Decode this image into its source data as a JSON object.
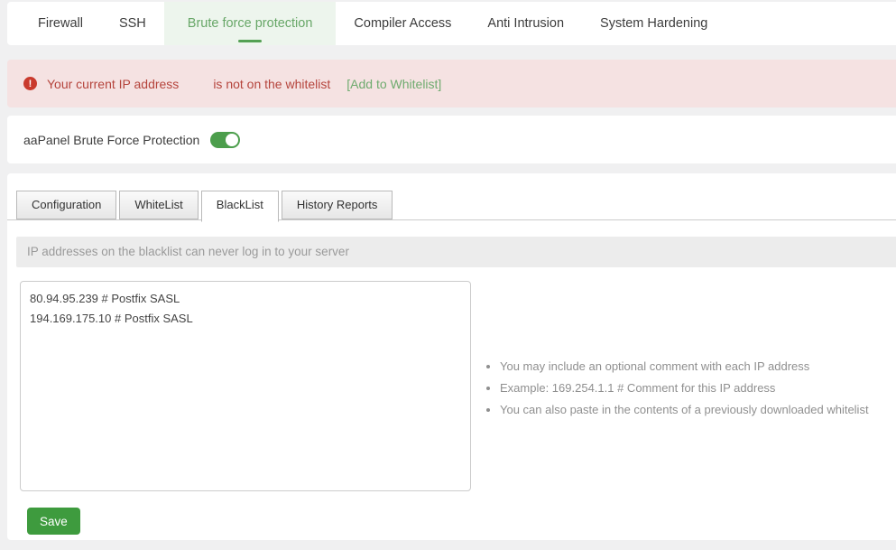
{
  "top_tabs": {
    "items": [
      {
        "label": "Firewall"
      },
      {
        "label": "SSH"
      },
      {
        "label": "Brute force protection"
      },
      {
        "label": "Compiler Access"
      },
      {
        "label": "Anti Intrusion"
      },
      {
        "label": "System Hardening"
      }
    ],
    "active_label": "Brute force protection",
    "active_color": "#68a768",
    "active_bg": "#edf5ed"
  },
  "banner": {
    "icon": "exclamation-circle-icon",
    "icon_glyph": "!",
    "message_prefix": "Your current IP address",
    "message_suffix": "is not on the whitelist",
    "action_label": "[Add to Whitelist]",
    "bg_color": "#f5e2e2",
    "text_color": "#b5443c",
    "link_color": "#6fab6f"
  },
  "protection": {
    "label": "aaPanel Brute Force Protection",
    "toggle_state": "on",
    "toggle_color": "#4c9e4c"
  },
  "sub_tabs": {
    "items": [
      {
        "label": "Configuration"
      },
      {
        "label": "WhiteList"
      },
      {
        "label": "BlackList"
      },
      {
        "label": "History Reports"
      }
    ],
    "active_label": "BlackList"
  },
  "blacklist_panel": {
    "info_text": "IP addresses on the blacklist can never log in to your server",
    "textarea_value": "80.94.95.239 # Postfix SASL\n194.169.175.10 # Postfix SASL",
    "tips": [
      "You may include an optional comment with each IP address",
      "Example: 169.254.1.1 # Comment for this IP address",
      "You can also paste in the contents of a previously downloaded whitelist"
    ],
    "save_label": "Save"
  }
}
